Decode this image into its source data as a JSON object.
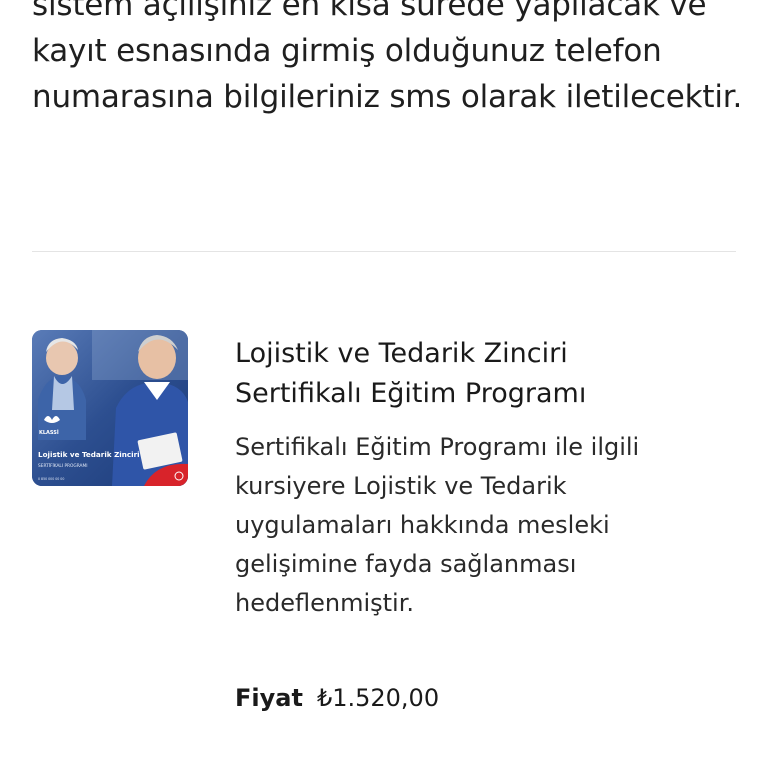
{
  "intro_text": "sistem açılışınız en kısa sürede yapılacak ve kayıt esnasında girmiş olduğunuz telefon numarasına bilgileriniz sms olarak iletilecektir.",
  "product": {
    "title": "Lojistik ve Tedarik Zinciri Sertifikalı Eğitim Programı",
    "description": "Sertifikalı Eğitim Programı ile ilgili kursiyere Lojistik ve Tedarik uygulamaları hakkında mesleki gelişimine fayda sağlanması hedeflenmiştir.",
    "price_label": "Fiyat",
    "price_value": "₺1.520,00",
    "image": {
      "brand": "KLASSİ",
      "heading": "Lojistik ve Tedarik Zinciri",
      "subheading": "SERTİFİKALI PROGRAMI"
    }
  },
  "colors": {
    "image_bg": "#2a4a8a",
    "divider": "#e4e4e4",
    "accent_red": "#d8232a"
  }
}
